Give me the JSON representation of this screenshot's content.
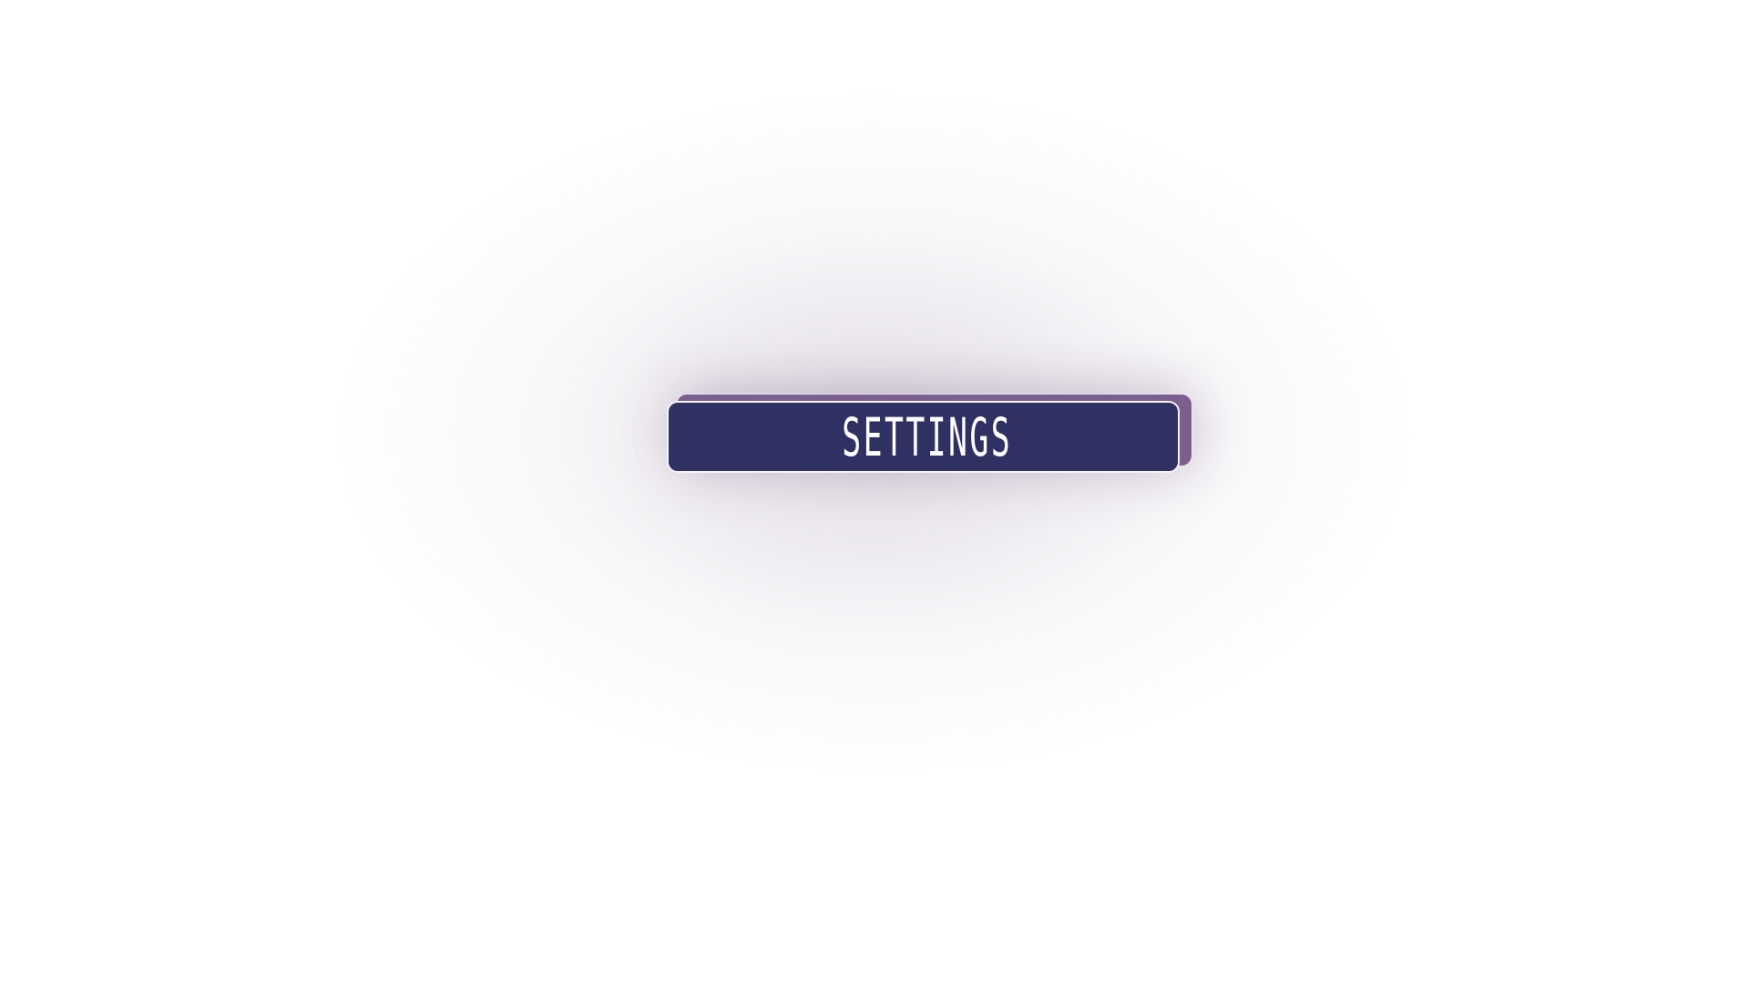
{
  "main": {
    "button": {
      "label": "SETTINGS"
    }
  },
  "colors": {
    "background": "#ffffff",
    "button_face": "#303163",
    "button_back": "#7a5f8f",
    "button_border": "#f4f1f8",
    "label": "#ffffff",
    "glow": "#48285c"
  }
}
